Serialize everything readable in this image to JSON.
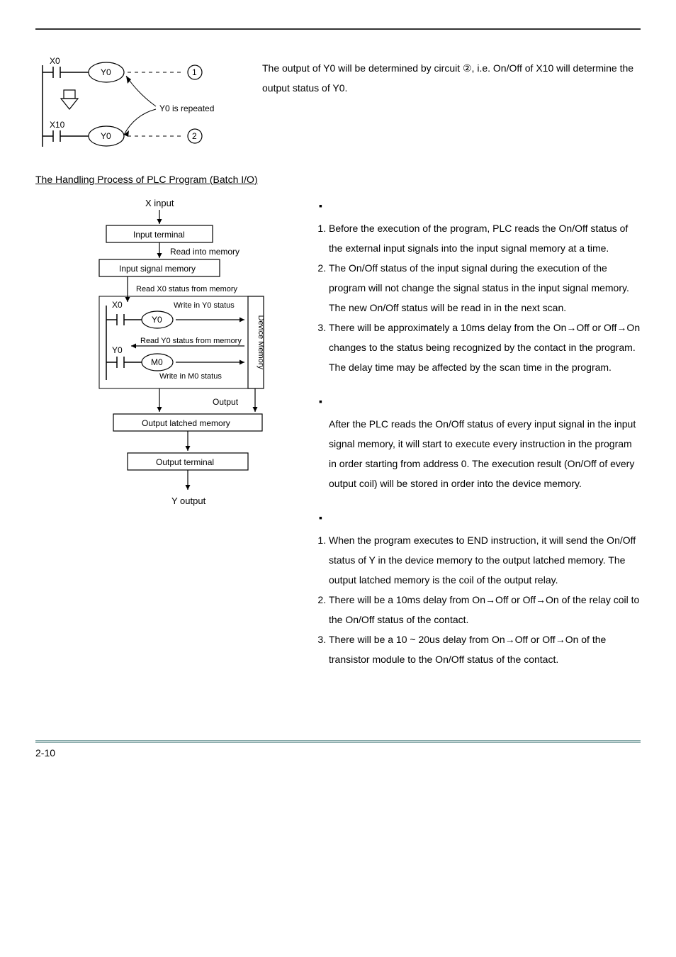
{
  "top_paragraph": "The output of Y0 will be determined by circuit ②, i.e. On/Off of X10 will determine the output status of Y0.",
  "ladder": {
    "x0": "X0",
    "x10": "X10",
    "y0_1": "Y0",
    "y0_2": "Y0",
    "num1": "1",
    "num2": "2",
    "repeated": "Y0 is repeated"
  },
  "section_heading": "The Handling Process of PLC Program (Batch I/O)",
  "flow": {
    "x_input": "X input",
    "input_terminal": "Input terminal",
    "read_into_memory": "Read into memory",
    "input_signal_memory": "Input signal memory",
    "read_x0": "Read X0 status from memory",
    "x0": "X0",
    "y0_coil": "Y0",
    "write_y0": "Write in Y0 status",
    "y0_contact": "Y0",
    "read_y0": "Read Y0 status from memory",
    "m0": "M0",
    "write_m0": "Write in M0 status",
    "device_memory": "Device Memory",
    "output_label": "Output",
    "output_latched": "Output latched memory",
    "output_terminal": "Output terminal",
    "y_output": "Y output"
  },
  "group1": {
    "i1": "Before the execution of the program, PLC reads the On/Off status of the external input signals into the input signal memory at a time.",
    "i2": "The On/Off status of the input signal during the execution of the program will not change the signal status in the input signal memory. The new On/Off status will be read in in the next scan.",
    "i3": "There will be approximately a 10ms delay from the On→Off or Off→On changes to the status being recognized by the contact in the program. The delay time may be affected by the scan time in the program."
  },
  "middle_para": "After the PLC reads the On/Off status of every input signal in the input signal memory, it will start to execute every instruction in the program in order starting from address 0. The execution result (On/Off of every output coil) will be stored in order into the device memory.",
  "group2": {
    "i1": "When the program executes to END instruction, it will send the On/Off status of Y in the device memory to the output latched memory. The output latched memory is the coil of the output relay.",
    "i2": "There will be a 10ms delay from On→Off or Off→On of the relay coil to the On/Off status of the contact.",
    "i3": "There will be a 10 ~ 20us delay from On→Off or Off→On of the transistor module to the On/Off status of the contact."
  },
  "footer": "2-10"
}
